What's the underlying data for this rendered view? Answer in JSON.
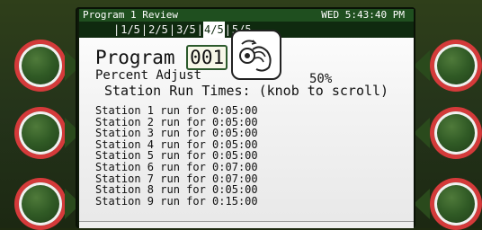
{
  "topbar": {
    "title": "Program 1 Review",
    "datetime": "WED 5:43:40 PM"
  },
  "tabs": [
    {
      "label": "1/5"
    },
    {
      "label": "2/5"
    },
    {
      "label": "3/5"
    },
    {
      "label": "4/5"
    },
    {
      "label": "5/5"
    }
  ],
  "program": {
    "label": "Program",
    "number": "001"
  },
  "percent_adjust": {
    "label": "Percent Adjust",
    "value": "50%"
  },
  "run_times_heading": "Station Run Times: (knob to scroll)",
  "stations": [
    "Station 1 run for 0:05:00",
    "Station 2 run for 0:05:00",
    "Station 3 run for 0:05:00",
    "Station 4 run for 0:05:00",
    "Station 5 run for 0:05:00",
    "Station 6 run for 0:07:00",
    "Station 7 run for 0:07:00",
    "Station 8 run for 0:05:00",
    "Station 9 run for 0:15:00"
  ],
  "colors": {
    "accent_green": "#1f4f1f",
    "button_ring": "#d43a3a"
  }
}
